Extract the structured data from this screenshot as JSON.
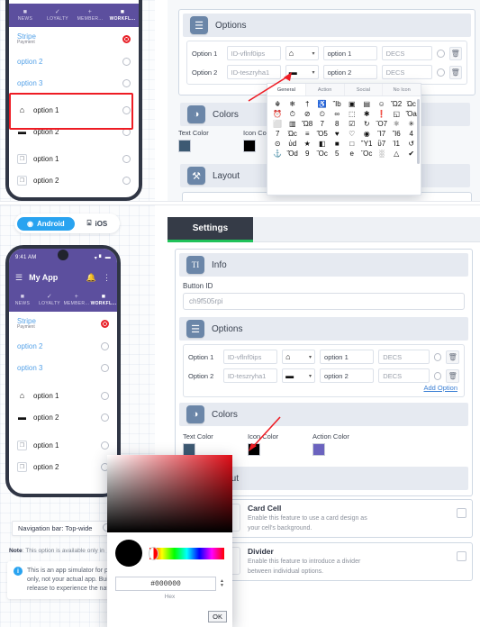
{
  "meta": {
    "accent_purple": "#5c4f9e",
    "accent_blue": "#29a3f0",
    "accent_green": "#21c25a",
    "annotation_red": "#ee1c24",
    "section_icon_bg": "#6b86a8"
  },
  "phone_preview": {
    "status_time": "9:41 AM",
    "status_icons": [
      "wifi-icon",
      "signal-icon",
      "battery-icon"
    ],
    "appbar": {
      "menu_icon": "hamburger-icon",
      "title": "My App",
      "bell_icon": "bell-icon",
      "more_icon": "more-vertical-icon"
    },
    "nav_tabs": [
      {
        "glyph": "■",
        "label": "NEWS",
        "icon": "news-icon",
        "active": false
      },
      {
        "glyph": "✓",
        "label": "LOYALTY",
        "icon": "check-icon",
        "active": false
      },
      {
        "glyph": "+",
        "label": "MEMBER...",
        "icon": "plus-icon",
        "active": false
      },
      {
        "glyph": "■",
        "label": "WORKFL...",
        "icon": "workflow-icon",
        "active": true
      }
    ],
    "list": [
      {
        "label": "Stripe",
        "sub": "Payment",
        "style": "link",
        "selected": true,
        "lead": ""
      },
      {
        "label": "option 2",
        "sub": "",
        "style": "link",
        "selected": false,
        "lead": ""
      },
      {
        "label": "option 3",
        "sub": "",
        "style": "link",
        "selected": false,
        "lead": ""
      },
      {
        "label": "option 1",
        "sub": "",
        "style": "plain",
        "selected": false,
        "lead": "⌂",
        "lead_icon": "home-icon"
      },
      {
        "label": "option 2",
        "sub": "",
        "style": "plain",
        "selected": false,
        "lead": "▬",
        "lead_icon": "briefcase-icon"
      },
      {
        "label": "option 1",
        "sub": "",
        "style": "plain",
        "selected": false,
        "lead": "❐",
        "lead_icon": "image-placeholder-icon",
        "boxed": true
      },
      {
        "label": "option 2",
        "sub": "",
        "style": "plain",
        "selected": false,
        "lead": "❐",
        "lead_icon": "image-placeholder-icon",
        "boxed": true
      }
    ]
  },
  "platform_toggle": {
    "options": [
      {
        "label": "Android",
        "icon": "android-icon",
        "glyph": "◉",
        "active": true
      },
      {
        "label": "iOS",
        "icon": "apple-icon",
        "glyph": "⌺",
        "active": false
      }
    ]
  },
  "navigation_bar_select": {
    "value": "Navigation bar: Top-wide",
    "chevron": "chevron-down-icon"
  },
  "note": {
    "prefix": "Note",
    "text": ": This option is available only in"
  },
  "simulator_info": {
    "icon": "info-icon",
    "lines": [
      "This is an app simulator for pr",
      "only, not your actual app. Build",
      "release to experience the nativ"
    ]
  },
  "settings": {
    "tab_label": "Settings",
    "info_section": {
      "icon": "text-format-icon",
      "glyph": "TI",
      "title": "Info",
      "field_label": "Button ID",
      "button_id_value": "ch9f505rpi"
    },
    "options_section": {
      "icon": "list-icon",
      "glyph": "☰",
      "title": "Options",
      "add_option_label": "Add Option",
      "rows": [
        {
          "label": "Option 1",
          "id_value": "ID-vflnf0ips",
          "icon_glyph": "⌂",
          "icon_name": "home-icon",
          "caret": "caret-down-icon",
          "name_value": "option 1",
          "desc_placeholder": "DECS",
          "radio_icon": "radio-unchecked-icon",
          "delete_icon": "trash-icon"
        },
        {
          "label": "Option 2",
          "id_value": "ID-teszryha1",
          "icon_glyph": "▬",
          "icon_name": "briefcase-icon",
          "caret": "caret-down-icon",
          "name_value": "option 2",
          "desc_placeholder": "DECS",
          "radio_icon": "radio-unchecked-icon",
          "delete_icon": "trash-icon"
        }
      ]
    },
    "colors_section": {
      "icon": "palette-icon",
      "glyph": "◑",
      "title": "Colors",
      "items": [
        {
          "label": "Text Color",
          "value": "#3d5a73"
        },
        {
          "label": "Icon Color",
          "value": "#000000"
        },
        {
          "label": "Action Color",
          "value": "#6b63bf"
        }
      ]
    },
    "layout_section": {
      "icon": "tools-icon",
      "glyph": "⚒",
      "title": "Layout"
    },
    "feature_rows": [
      {
        "title": "Card Cell",
        "description_lines": [
          "Enable this feature to use a card design as",
          "your cell's background."
        ],
        "checkbox": "checkbox-unchecked-icon",
        "radios": [
          "radio-checked-icon",
          "radio-unchecked-icon"
        ]
      },
      {
        "title": "Divider",
        "description_lines": [
          "Enable this feature to introduce a divider",
          "between individual options."
        ],
        "checkbox": "checkbox-unchecked-icon",
        "radios": [
          "radio-checked-icon",
          "radio-unchecked-icon"
        ]
      }
    ]
  },
  "icon_picker": {
    "tabs": [
      {
        "label": "General",
        "active": true
      },
      {
        "label": "Action",
        "active": false
      },
      {
        "label": "Social",
        "active": false
      },
      {
        "label": "No Icon",
        "active": false
      }
    ],
    "icons": [
      "☬",
      "❄",
      "†",
      "♿",
      "Ἵb",
      "▣",
      "▤",
      "☺",
      "Ὥ2",
      "Ὠc",
      "⏰",
      "⏱",
      "⊘",
      "⏲",
      "∞",
      "⬚",
      "✱",
      "❗",
      "◱",
      "Ὄa",
      "⬜",
      "▥",
      "Ὤ8",
      "὏7",
      "὏8",
      "☑",
      "↻",
      "Ὂ7",
      "⚛",
      "✳",
      "὚7",
      "Ὠc",
      "≡",
      "Ὄ5",
      "♥",
      "♡",
      "◉",
      "Ἲ7",
      "Ἴ6",
      "὆4",
      "⊙",
      "ὐd",
      "★",
      "◧",
      "■",
      "□",
      "Ὕ1",
      "ὒ7",
      "Ἰ1",
      "↺",
      "⚓",
      "Ὅd",
      "὏9",
      "Ὃc",
      "὚5",
      "὜e",
      "Ὃc",
      "░",
      "△",
      "✔"
    ]
  },
  "color_picker_overlay": {
    "hex_value": "#000000",
    "hex_label": "Hex",
    "ok_label": "OK",
    "preview_color": "#000000"
  }
}
